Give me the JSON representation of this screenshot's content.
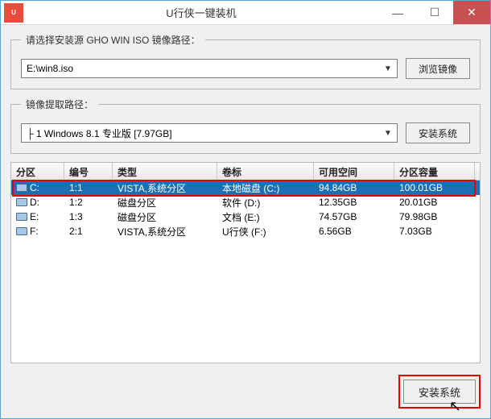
{
  "window": {
    "title": "U行侠一键装机",
    "app_icon_label": "U"
  },
  "controls": {
    "minimize": "—",
    "maximize": "☐",
    "close": "✕"
  },
  "source": {
    "legend": "请选择安装源 GHO WIN ISO 镜像路径：",
    "value": "E:\\win8.iso",
    "browse_label": "浏览镜像"
  },
  "extract": {
    "legend": "镜像提取路径：",
    "value": "├ 1 Windows 8.1 专业版 [7.97GB]",
    "install_label": "安装系统"
  },
  "table": {
    "headers": [
      "分区",
      "编号",
      "类型",
      "卷标",
      "可用空间",
      "分区容量"
    ],
    "rows": [
      {
        "drive": "C:",
        "num": "1:1",
        "type": "VISTA,系统分区",
        "label": "本地磁盘 (C:)",
        "free": "94.84GB",
        "size": "100.01GB",
        "selected": true
      },
      {
        "drive": "D:",
        "num": "1:2",
        "type": "磁盘分区",
        "label": "软件 (D:)",
        "free": "12.35GB",
        "size": "20.01GB",
        "selected": false
      },
      {
        "drive": "E:",
        "num": "1:3",
        "type": "磁盘分区",
        "label": "文档 (E:)",
        "free": "74.57GB",
        "size": "79.98GB",
        "selected": false
      },
      {
        "drive": "F:",
        "num": "2:1",
        "type": "VISTA,系统分区",
        "label": "U行侠 (F:)",
        "free": "6.56GB",
        "size": "7.03GB",
        "selected": false
      }
    ]
  },
  "footer": {
    "install_label": "安装系统"
  }
}
